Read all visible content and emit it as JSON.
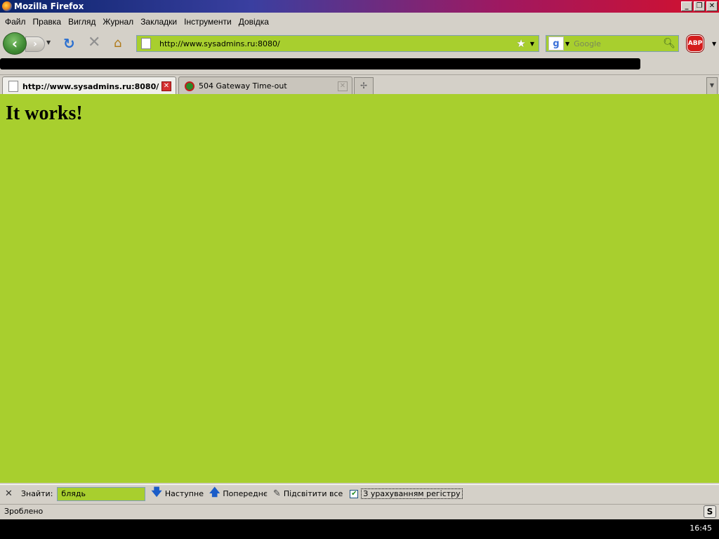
{
  "window": {
    "title": "Mozilla Firefox",
    "min_symbol": "_",
    "restore_symbol": "❐",
    "close_symbol": "✕"
  },
  "menu": {
    "items": [
      {
        "label": "Файл"
      },
      {
        "label": "Правка"
      },
      {
        "label": "Вигляд"
      },
      {
        "label": "Журнал"
      },
      {
        "label": "Закладки"
      },
      {
        "label": "Інструменти"
      },
      {
        "label": "Довідка"
      }
    ]
  },
  "navbar": {
    "url": "http://www.sysadmins.ru:8080/",
    "search_placeholder": "Google",
    "adblock_label": "ABP"
  },
  "tabs": [
    {
      "title": "http://www.sysadmins.ru:8080/",
      "active": true
    },
    {
      "title": "504 Gateway Time-out",
      "active": false
    }
  ],
  "content": {
    "heading": "It works!"
  },
  "findbar": {
    "label": "Знайти:",
    "query": "блядь",
    "next_label": "Наступне",
    "prev_label": "Попереднє",
    "highlight_label": "Підсвітити все",
    "match_case_label": "З урахуванням регістру",
    "match_case_checked": true
  },
  "status": {
    "text": "Зроблено"
  },
  "taskbar": {
    "clock": "16:45"
  },
  "colors": {
    "page_background": "#a8cf2e",
    "chrome": "#d4d0c8"
  }
}
